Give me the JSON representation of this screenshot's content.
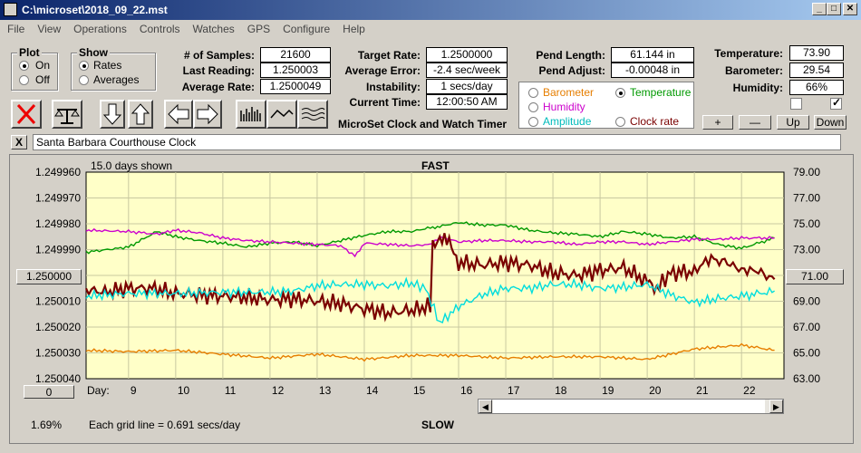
{
  "window": {
    "title": "C:\\microset\\2018_09_22.mst"
  },
  "menu": [
    "File",
    "View",
    "Operations",
    "Controls",
    "Watches",
    "GPS",
    "Configure",
    "Help"
  ],
  "plot_group": {
    "title": "Plot",
    "on": "On",
    "off": "Off",
    "selected": "On"
  },
  "show_group": {
    "title": "Show",
    "rates": "Rates",
    "averages": "Averages",
    "selected": "Rates"
  },
  "stats": {
    "samples_label": "# of Samples:",
    "samples": "21600",
    "last_label": "Last Reading:",
    "last": "1.250003",
    "avg_label": "Average Rate:",
    "avg": "1.2500049",
    "target_label": "Target Rate:",
    "target": "1.2500000",
    "avgerr_label": "Average Error:",
    "avgerr": "-2.4 sec/week",
    "instab_label": "Instability:",
    "instab": "1 secs/day",
    "time_label": "Current Time:",
    "time": "12:00:50 AM",
    "pendlen_label": "Pend Length:",
    "pendlen": "61.144 in",
    "pendadj_label": "Pend Adjust:",
    "pendadj": "-0.00048 in",
    "temp_label": "Temperature:",
    "temp": "73.90",
    "baro_label": "Barometer:",
    "baro": "29.54",
    "hum_label": "Humidity:",
    "hum": "66%"
  },
  "app_caption": "MicroSet Clock and Watch Timer",
  "sensor_options": [
    {
      "label": "Barometer",
      "color": "#e67e00",
      "selected": false
    },
    {
      "label": "Temperature",
      "color": "#009900",
      "selected": true
    },
    {
      "label": "Humidity",
      "color": "#cc00cc",
      "selected": false
    },
    {
      "label": "Clock rate",
      "color": "#7a0000",
      "selected": false
    },
    {
      "label": "Amplitude",
      "color": "#00cccc",
      "selected": false
    }
  ],
  "small_buttons": {
    "plus": "+",
    "minus": "—",
    "up": "Up",
    "down": "Down"
  },
  "watch_name": "Santa Barbara Courthouse Clock",
  "close_x": "X",
  "chart_top": {
    "days_shown": "15.0 days shown",
    "fast": "FAST"
  },
  "chart_bottom": {
    "slow": "SLOW",
    "grid_note": "Each grid line = 0.691 secs/day",
    "pct": "1.69%",
    "day_label": "Day:",
    "zero_button": "0"
  },
  "center_left_button": "1.250000",
  "center_right_button": "71.00",
  "chart_data": {
    "type": "line",
    "x_label": "Day",
    "x_ticks": [
      9,
      10,
      11,
      12,
      13,
      14,
      15,
      16,
      17,
      18,
      19,
      20,
      21,
      22
    ],
    "xlim": [
      8.1,
      22.9
    ],
    "y_left_ticks": [
      "1.249960",
      "1.249970",
      "1.249980",
      "1.249990",
      "1.250000",
      "1.250010",
      "1.250020",
      "1.250030",
      "1.250040"
    ],
    "y_left_range": [
      1.24996,
      1.25004
    ],
    "y_left_inverted": true,
    "y_right_ticks": [
      "79.00",
      "77.00",
      "75.00",
      "73.00",
      "71.00",
      "69.00",
      "67.00",
      "65.00",
      "63.00"
    ],
    "y_right_range": [
      63,
      79
    ],
    "grid": true,
    "series": [
      {
        "name": "Barometer",
        "color": "#e67e00",
        "axis": "right",
        "points": [
          [
            8.1,
            65.2
          ],
          [
            9,
            65.1
          ],
          [
            10,
            65.2
          ],
          [
            11,
            64.9
          ],
          [
            12,
            64.6
          ],
          [
            13,
            64.9
          ],
          [
            14,
            64.5
          ],
          [
            15,
            64.8
          ],
          [
            16,
            64.8
          ],
          [
            17,
            64.6
          ],
          [
            18,
            64.7
          ],
          [
            19,
            64.7
          ],
          [
            20,
            64.5
          ],
          [
            21,
            65.3
          ],
          [
            22,
            65.6
          ],
          [
            22.7,
            65.2
          ]
        ]
      },
      {
        "name": "Temperature",
        "color": "#009900",
        "axis": "right",
        "points": [
          [
            8.1,
            72.8
          ],
          [
            9,
            73.2
          ],
          [
            9.6,
            74.4
          ],
          [
            10,
            74.0
          ],
          [
            10.5,
            73.7
          ],
          [
            11,
            73.5
          ],
          [
            11.5,
            73.2
          ],
          [
            12,
            73.5
          ],
          [
            12.5,
            73.6
          ],
          [
            13,
            73.3
          ],
          [
            13.5,
            73.7
          ],
          [
            14,
            74.1
          ],
          [
            14.5,
            74.4
          ],
          [
            15,
            74.4
          ],
          [
            15.4,
            74.7
          ],
          [
            15.6,
            74.8
          ],
          [
            16,
            75.1
          ],
          [
            16.5,
            74.9
          ],
          [
            17,
            74.9
          ],
          [
            17.5,
            74.5
          ],
          [
            18,
            74.3
          ],
          [
            18.5,
            74.2
          ],
          [
            19,
            74.0
          ],
          [
            19.5,
            74.4
          ],
          [
            20,
            74.2
          ],
          [
            20.5,
            73.9
          ],
          [
            21,
            74.0
          ],
          [
            21.5,
            73.4
          ],
          [
            22,
            73.1
          ],
          [
            22.7,
            73.9
          ]
        ]
      },
      {
        "name": "Humidity",
        "color": "#cc00cc",
        "axis": "right",
        "points": [
          [
            8.1,
            74.5
          ],
          [
            9,
            74.4
          ],
          [
            9.6,
            74.2
          ],
          [
            10,
            74.5
          ],
          [
            10.5,
            74.3
          ],
          [
            11,
            73.9
          ],
          [
            11.5,
            73.7
          ],
          [
            12,
            73.6
          ],
          [
            12.5,
            73.5
          ],
          [
            13,
            73.4
          ],
          [
            13.5,
            73.3
          ],
          [
            13.8,
            72.5
          ],
          [
            14,
            73.5
          ],
          [
            14.5,
            73.4
          ],
          [
            15,
            73.3
          ],
          [
            15.4,
            73.4
          ],
          [
            15.6,
            74.0
          ],
          [
            16,
            73.6
          ],
          [
            16.5,
            73.7
          ],
          [
            17,
            73.7
          ],
          [
            17.5,
            73.6
          ],
          [
            18,
            73.6
          ],
          [
            18.5,
            73.4
          ],
          [
            19,
            73.6
          ],
          [
            19.5,
            73.6
          ],
          [
            20,
            73.4
          ],
          [
            20.5,
            73.6
          ],
          [
            21,
            73.8
          ],
          [
            21.5,
            73.8
          ],
          [
            22,
            73.9
          ],
          [
            22.7,
            73.9
          ]
        ]
      },
      {
        "name": "Clock rate",
        "color": "#7a0000",
        "axis": "right",
        "points": [
          [
            8.1,
            69.9
          ],
          [
            8.5,
            69.7
          ],
          [
            9,
            70.0
          ],
          [
            9.5,
            70.0
          ],
          [
            10,
            69.6
          ],
          [
            10.5,
            69.5
          ],
          [
            11,
            69.4
          ],
          [
            11.5,
            69.3
          ],
          [
            12,
            69.1
          ],
          [
            12.5,
            69.2
          ],
          [
            13,
            69.0
          ],
          [
            13.5,
            68.8
          ],
          [
            14,
            68.4
          ],
          [
            14.5,
            68.1
          ],
          [
            15,
            68.3
          ],
          [
            15.4,
            68.6
          ],
          [
            15.45,
            73.5
          ],
          [
            15.6,
            74.0
          ],
          [
            15.8,
            73.4
          ],
          [
            16,
            72.0
          ],
          [
            16.5,
            71.8
          ],
          [
            17,
            72.0
          ],
          [
            17.5,
            71.8
          ],
          [
            18,
            71.2
          ],
          [
            18.5,
            71.0
          ],
          [
            19,
            71.4
          ],
          [
            19.5,
            71.6
          ],
          [
            20,
            70.5
          ],
          [
            20.2,
            70.0
          ],
          [
            20.5,
            71.2
          ],
          [
            21,
            71.3
          ],
          [
            21.3,
            72.3
          ],
          [
            21.7,
            72.0
          ],
          [
            22,
            71.4
          ],
          [
            22.3,
            71.4
          ],
          [
            22.7,
            70.7
          ]
        ]
      },
      {
        "name": "Amplitude",
        "color": "#00dddd",
        "axis": "right",
        "points": [
          [
            8.1,
            69.4
          ],
          [
            9,
            69.6
          ],
          [
            10,
            69.6
          ],
          [
            11,
            69.7
          ],
          [
            12,
            69.7
          ],
          [
            12.5,
            69.8
          ],
          [
            13,
            70.2
          ],
          [
            13.5,
            70.3
          ],
          [
            14,
            70.3
          ],
          [
            14.5,
            70.2
          ],
          [
            15,
            70.4
          ],
          [
            15.3,
            70.0
          ],
          [
            15.6,
            67.3
          ],
          [
            16,
            68.6
          ],
          [
            16.5,
            69.5
          ],
          [
            17,
            70.0
          ],
          [
            17.5,
            70.0
          ],
          [
            18,
            70.3
          ],
          [
            18.5,
            70.3
          ],
          [
            19,
            70.0
          ],
          [
            19.5,
            70.1
          ],
          [
            20,
            70.3
          ],
          [
            20.5,
            69.5
          ],
          [
            21,
            68.9
          ],
          [
            21.5,
            69.2
          ],
          [
            22,
            69.4
          ],
          [
            22.7,
            69.8
          ]
        ]
      }
    ]
  }
}
